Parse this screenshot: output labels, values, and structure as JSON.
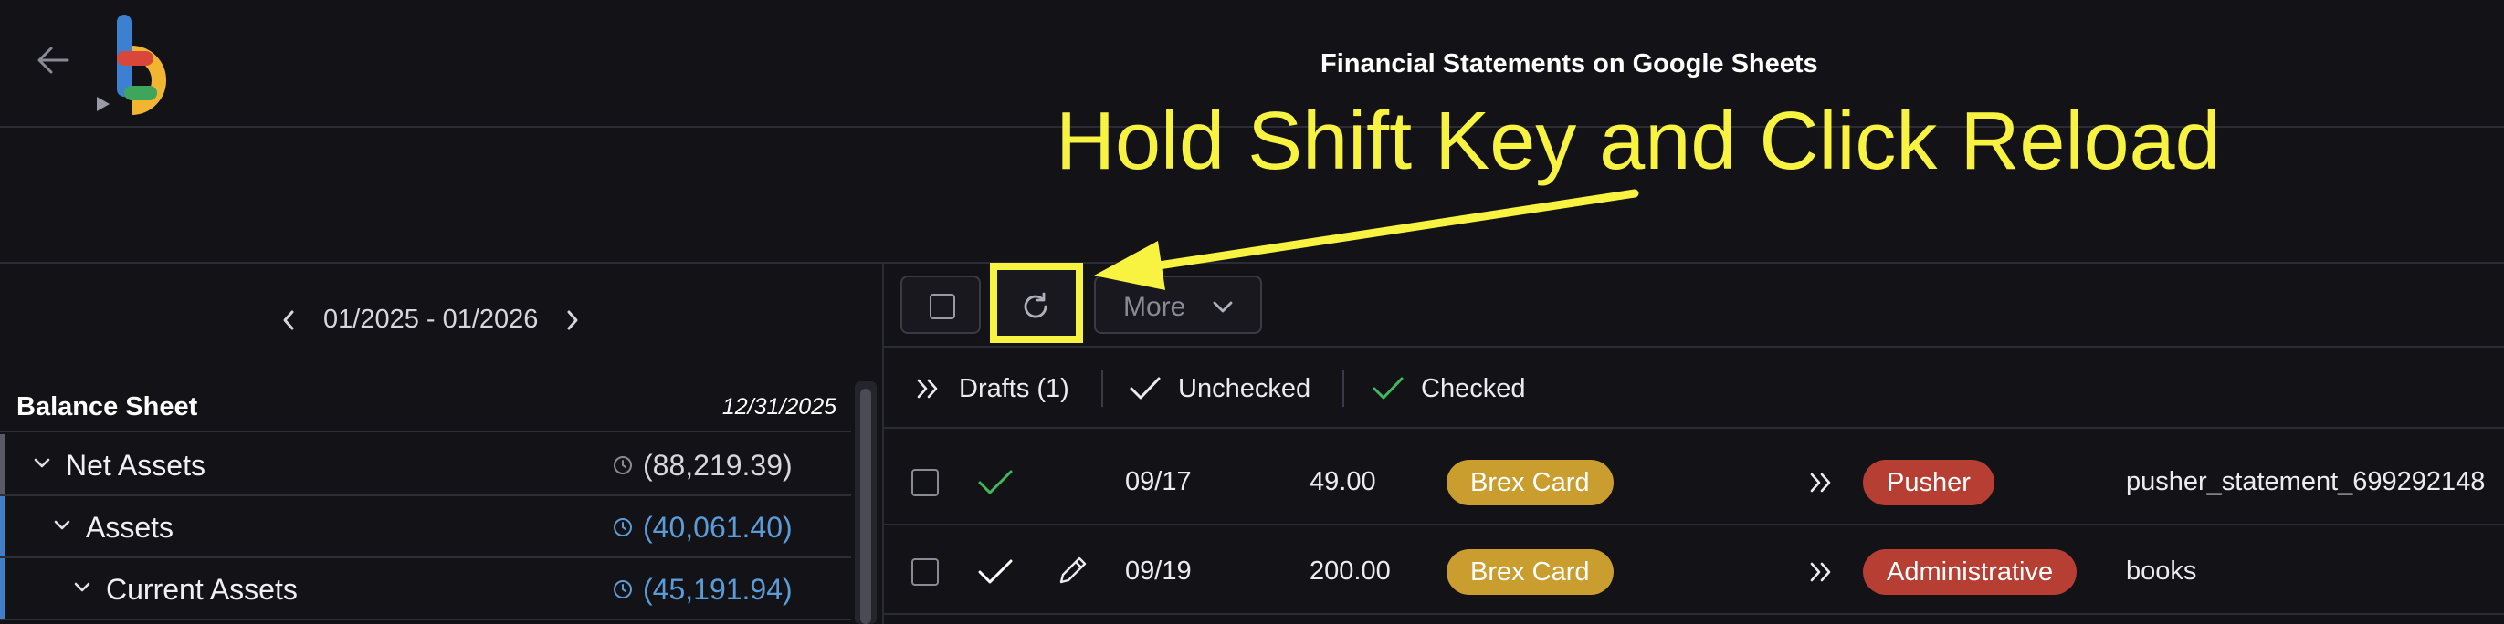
{
  "header": {
    "title": "Financial Statements on Google Sheets",
    "back_icon": "arrow-left-icon",
    "logo_icon": "app-logo-icon"
  },
  "annotation": {
    "text": "Hold Shift Key and Click Reload",
    "color": "#f7f340"
  },
  "left_panel": {
    "date_range": "01/2025 - 01/2026",
    "balance_sheet": {
      "title": "Balance Sheet",
      "date": "12/31/2025",
      "rows": [
        {
          "label": "Net Assets",
          "amount": "(88,219.39)",
          "amount_color": "#d6d6dc",
          "bar_color": "#5a5a64"
        },
        {
          "label": "Assets",
          "amount": "(40,061.40)",
          "amount_color": "#5b9bd8",
          "bar_color": "#3f7fc8"
        },
        {
          "label": "Current Assets",
          "amount": "(45,191.94)",
          "amount_color": "#5b9bd8",
          "bar_color": "#3f7fc8"
        }
      ]
    }
  },
  "toolbar": {
    "select_all_icon": "checkbox-icon",
    "reload_icon": "reload-icon",
    "more_label": "More"
  },
  "filters": {
    "drafts": "Drafts (1)",
    "unchecked": "Unchecked",
    "checked": "Checked"
  },
  "transactions": [
    {
      "date": "09/17",
      "amount": "49.00",
      "account": "Brex Card",
      "category": "Pusher",
      "description": "pusher_statement_699292148",
      "status": "checked-green"
    },
    {
      "date": "09/19",
      "amount": "200.00",
      "account": "Brex Card",
      "category": "Administrative",
      "description": "books",
      "status": "unchecked-white"
    }
  ],
  "colors": {
    "background": "#121217",
    "tag_account": "#c99d2e",
    "tag_category": "#b63e32",
    "check_green": "#3dbb5a"
  }
}
